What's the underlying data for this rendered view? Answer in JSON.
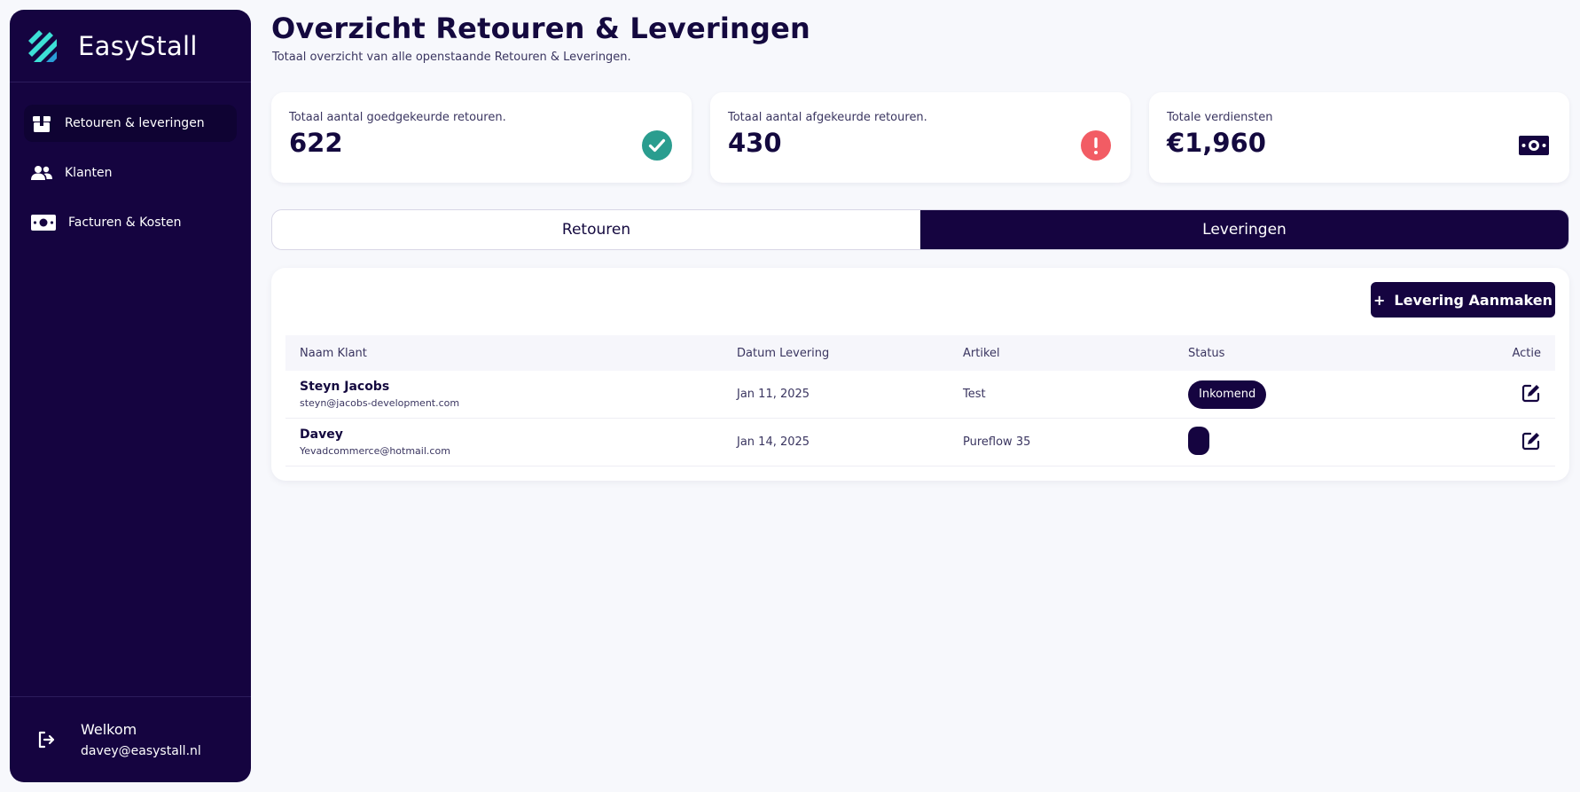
{
  "brand": {
    "name": "EasyStall"
  },
  "sidebar": {
    "items": [
      {
        "label": "Retouren & leveringen",
        "icon": "package-icon",
        "active": true
      },
      {
        "label": "Klanten",
        "icon": "users-icon",
        "active": false
      },
      {
        "label": "Facturen & Kosten",
        "icon": "money-icon",
        "active": false
      }
    ],
    "footer": {
      "welcome": "Welkom",
      "email": "davey@easystall.nl"
    }
  },
  "header": {
    "title": "Overzicht Retouren & Leveringen",
    "subtitle": "Totaal overzicht van alle openstaande Retouren & Leveringen."
  },
  "stats": [
    {
      "label": "Totaal aantal goedgekeurde retouren.",
      "value": "622",
      "icon": "check-circle-icon",
      "color": "#2a9d8f"
    },
    {
      "label": "Totaal aantal afgekeurde retouren.",
      "value": "430",
      "icon": "alert-circle-icon",
      "color": "#f25c64"
    },
    {
      "label": "Totale verdiensten",
      "value": "€1,960",
      "icon": "money-icon",
      "color": "#150440"
    }
  ],
  "tabs": [
    {
      "label": "Retouren",
      "active": false
    },
    {
      "label": "Leveringen",
      "active": true
    }
  ],
  "actions": {
    "create_label": "Levering Aanmaken"
  },
  "table": {
    "columns": [
      "Naam Klant",
      "Datum Levering",
      "Artikel",
      "Status",
      "Actie"
    ],
    "rows": [
      {
        "name": "Steyn Jacobs",
        "email": "steyn@jacobs-development.com",
        "date": "Jan 11, 2025",
        "article": "Test",
        "status": "Inkomend"
      },
      {
        "name": "Davey",
        "email": "Yevadcommerce@hotmail.com",
        "date": "Jan 14, 2025",
        "article": "Pureflow 35",
        "status": ""
      }
    ]
  },
  "colors": {
    "primary": "#150440",
    "background": "#f7f8fc",
    "success": "#2a9d8f",
    "danger": "#f25c64",
    "logo_accent": "#3de0d6"
  }
}
